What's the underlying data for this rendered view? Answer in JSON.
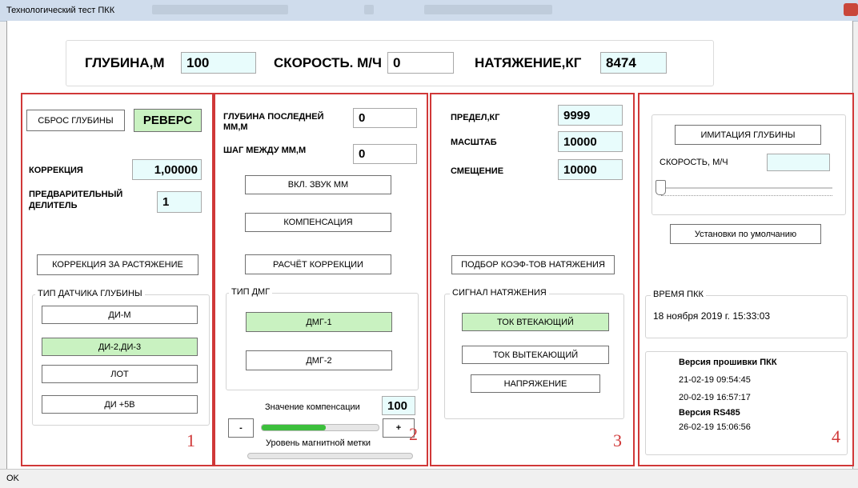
{
  "window": {
    "title": "Технологический тест ПКК"
  },
  "header": {
    "depth_label": "ГЛУБИНА,М",
    "depth_value": "100",
    "speed_label": "СКОРОСТЬ. М/Ч",
    "speed_value": "0",
    "tension_label": "НАТЯЖЕНИЕ,КГ",
    "tension_value": "8474"
  },
  "panel1": {
    "reset_depth_btn": "СБРОС ГЛУБИНЫ",
    "reverse_btn": "РЕВЕРС",
    "correction_label": "КОРРЕКЦИЯ",
    "correction_value": "1,00000",
    "predivider_label": "ПРЕДВАРИТЕЛЬНЫЙ ДЕЛИТЕЛЬ",
    "predivider_value": "1",
    "stretch_correction_btn": "КОРРЕКЦИЯ ЗА РАСТЯЖЕНИЕ",
    "sensor_type_title": "ТИП ДАТЧИКА ГЛУБИНЫ",
    "sensor_options": [
      "ДИ-М",
      "ДИ-2,ДИ-3",
      "ЛОТ",
      "ДИ +5В"
    ],
    "number": "1"
  },
  "panel2": {
    "last_mm_depth_label": "ГЛУБИНА ПОСЛЕДНЕЙ ММ,М",
    "last_mm_depth_value": "0",
    "mm_step_label": "ШАГ МЕЖДУ ММ,М",
    "mm_step_value": "0",
    "sound_btn": "ВКЛ. ЗВУК ММ",
    "compensation_btn": "КОМПЕНСАЦИЯ",
    "calc_correction_btn": "РАСЧЁТ КОРРЕКЦИИ",
    "dmg_type_title": "ТИП ДМГ",
    "dmg_options": [
      "ДМГ-1",
      "ДМГ-2"
    ],
    "compensation_value_label": "Значение компенсации",
    "compensation_value": "100",
    "minus_btn": "-",
    "plus_btn": "+",
    "compensation_level": 0.55,
    "magnetic_mark_label": "Уровень магнитной метки",
    "magnetic_mark_level": 0.0,
    "number": "2"
  },
  "panel3": {
    "limit_label": "ПРЕДЕЛ,КГ",
    "limit_value": "9999",
    "scale_label": "МАСШТАБ",
    "scale_value": "10000",
    "offset_label": "СМЕЩЕНИЕ",
    "offset_value": "10000",
    "coef_btn": "ПОДБОР КОЭФ-ТОВ НАТЯЖЕНИЯ",
    "signal_title": "СИГНАЛ НАТЯЖЕНИЯ",
    "signal_options": [
      "ТОК ВТЕКАЮЩИЙ",
      "ТОК ВЫТЕКАЮЩИЙ",
      "НАПРЯЖЕНИЕ"
    ],
    "number": "3"
  },
  "panel4": {
    "imitation_btn": "ИМИТАЦИЯ ГЛУБИНЫ",
    "speed_label": "СКОРОСТЬ, М/Ч",
    "speed_value": "",
    "speed_slider_level": 0.0,
    "defaults_btn": "Установки по умолчанию",
    "time_title": "ВРЕМЯ ПКК",
    "time_value": "18 ноября 2019 г.  15:33:03",
    "firmware_title": "Версия прошивки ПКК",
    "firmware_date1": "21-02-19 09:54:45",
    "firmware_date2": "20-02-19 16:57:17",
    "rs485_title": "Версия RS485",
    "rs485_date": "26-02-19 15:06:56",
    "number": "4"
  },
  "status": {
    "text": "OK"
  },
  "colors": {
    "selected": "#c9f2c1",
    "panel_border": "#d03838",
    "field_cyan": "#e8fcfc"
  }
}
